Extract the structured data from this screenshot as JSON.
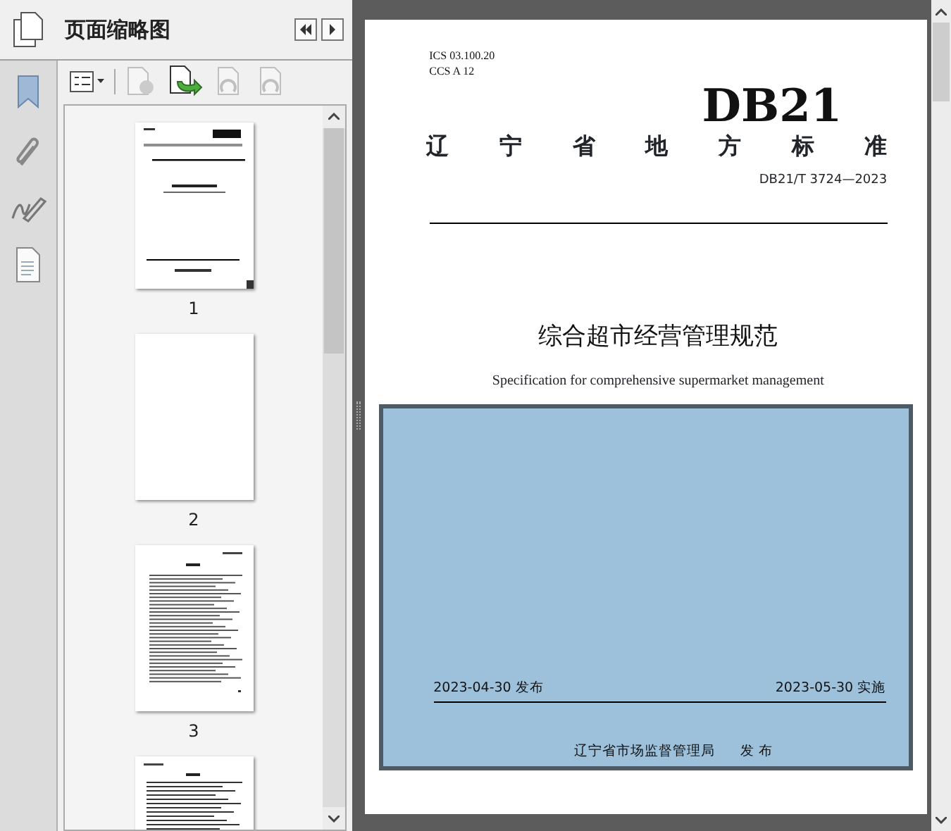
{
  "panel": {
    "title": "页面缩略图",
    "toolbar": [
      {
        "disabled": false
      },
      {
        "disabled": true
      },
      {
        "disabled": false
      },
      {
        "disabled": true
      },
      {
        "disabled": true
      }
    ],
    "thumbnails": [
      {
        "kind": "cover",
        "label": "1",
        "selected": true
      },
      {
        "kind": "blank",
        "label": "2",
        "selected": false
      },
      {
        "kind": "contents",
        "label": "3",
        "selected": false
      },
      {
        "kind": "text",
        "selected": false
      }
    ]
  },
  "document": {
    "ics": "ICS  03.100.20",
    "ccs": "CCS  A 12",
    "code": "DB21",
    "category": "辽 宁 省 地 方 标 准",
    "number": "DB21/T 3724—2023",
    "title": "综合超市经营管理规范",
    "subtitle": "Specification for comprehensive supermarket management",
    "publish_date": "2023-04-30 发布",
    "effective_date": "2023-05-30 实施",
    "issuer": "辽宁省市场监督管理局",
    "issue_word": "发 布"
  }
}
